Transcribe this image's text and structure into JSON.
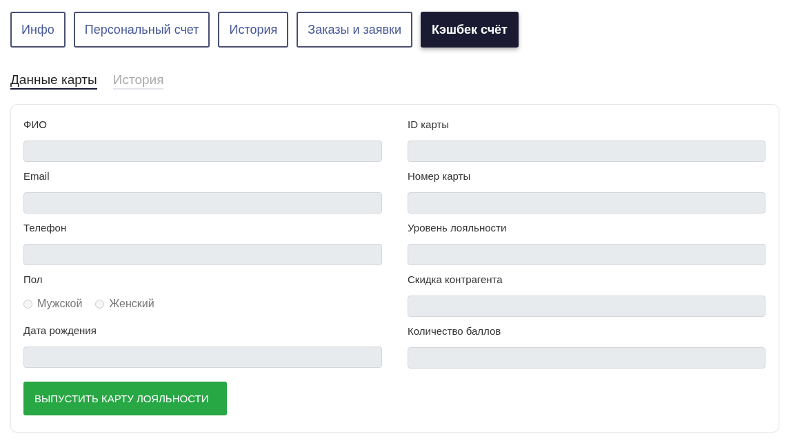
{
  "tabs": [
    {
      "label": "Инфо",
      "selected": false
    },
    {
      "label": "Персональный счет",
      "selected": false
    },
    {
      "label": "История",
      "selected": false
    },
    {
      "label": "Заказы и заявки",
      "selected": false
    },
    {
      "label": "Кэшбек счёт",
      "selected": true
    }
  ],
  "subtabs": [
    {
      "label": "Данные карты",
      "selected": true
    },
    {
      "label": "История",
      "selected": false
    }
  ],
  "left_fields": [
    {
      "kind": "text",
      "label": "ФИО",
      "disabled": true
    },
    {
      "kind": "text",
      "label": "Email",
      "disabled": true
    },
    {
      "kind": "text",
      "label": "Телефон",
      "disabled": true
    },
    {
      "kind": "radio",
      "label": "Пол",
      "options": [
        {
          "label": "Мужской",
          "selected": false
        },
        {
          "label": "Женский",
          "selected": false
        }
      ]
    },
    {
      "kind": "text",
      "label": "Дата рождения",
      "disabled": true
    }
  ],
  "right_fields": [
    {
      "kind": "text",
      "label": "ID карты",
      "disabled": true
    },
    {
      "kind": "text",
      "label": "Номер карты",
      "disabled": true
    },
    {
      "kind": "text",
      "label": "Уровень лояльности",
      "disabled": true
    },
    {
      "kind": "text",
      "label": "Скидка контрагента",
      "disabled": true
    },
    {
      "kind": "text",
      "label": "Количество баллов",
      "disabled": true
    }
  ],
  "submit_button": "ВЫПУСТИТЬ КАРТУ ЛОЯЛЬНОСТИ"
}
